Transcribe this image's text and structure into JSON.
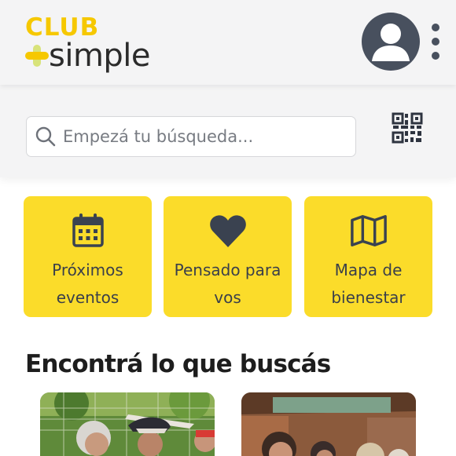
{
  "header": {
    "logo": {
      "club_text": "CLUB",
      "simple_text": "simple",
      "colors": {
        "club": "#f6c800",
        "plus_light": "#d8e37a",
        "plus_dark": "#f6c800",
        "simple": "#2b2b2b"
      }
    },
    "avatar_icon": "user-avatar-icon",
    "menu_icon": "vertical-dots-icon"
  },
  "search": {
    "placeholder": "Empezá tu búsqueda...",
    "value": "",
    "icon": "search-icon",
    "qr_icon": "qr-code-icon"
  },
  "quick_links": [
    {
      "icon": "calendar-icon",
      "line1": "Próximos",
      "line2": "eventos"
    },
    {
      "icon": "heart-icon",
      "line1": "Pensado para",
      "line2": "vos"
    },
    {
      "icon": "map-icon",
      "line1": "Mapa de",
      "line2": "bienestar"
    }
  ],
  "section": {
    "title": "Encontrá lo que buscás"
  },
  "cards": [
    {
      "image_icon": "photo-icon"
    },
    {
      "image_icon": "photo-icon"
    }
  ],
  "colors": {
    "accent": "#fbdc2a",
    "icon": "#3a4250",
    "header_bg": "#f4f4f5",
    "text": "#1d1d1d"
  }
}
